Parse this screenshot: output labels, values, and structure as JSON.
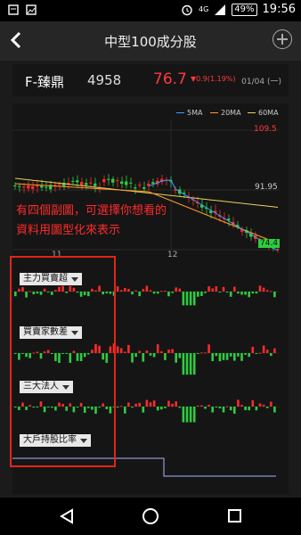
{
  "status_bar": {
    "network": "4G",
    "battery": "49%",
    "time": "19:56",
    "icons": [
      "notification-icon",
      "image-icon",
      "alarm-icon",
      "signal-icon",
      "battery-icon"
    ]
  },
  "header": {
    "title": "中型100成分股"
  },
  "stock": {
    "name": "F-臻鼎",
    "code": "4958",
    "price": "76.7",
    "change": "▼0.9(1.19%)",
    "date": "01/04 (一)"
  },
  "legend": [
    {
      "label": "5MA",
      "color": "#3aa0ff"
    },
    {
      "label": "20MA",
      "color": "#ff9a2a"
    },
    {
      "label": "60MA",
      "color": "#e8d060"
    }
  ],
  "price_labels": {
    "high": "109.5",
    "mid": "91.95",
    "low": "74.4"
  },
  "x_labels": [
    "11",
    "12"
  ],
  "annotation": {
    "line1": "有四個副圖，可選擇你想看的",
    "line2": "資料用圖型化來表示"
  },
  "sub_charts": [
    {
      "label": "主力買賣超"
    },
    {
      "label": "買賣家數差"
    },
    {
      "label": "三大法人"
    },
    {
      "label": "大戶持股比率"
    }
  ],
  "colors": {
    "up": "#ff2a2a",
    "down": "#2ecc40",
    "annotation_frame": "#e1251b"
  },
  "chart_data": [
    {
      "type": "line",
      "title": "",
      "series": [
        {
          "name": "5MA",
          "values": []
        },
        {
          "name": "20MA",
          "values": []
        },
        {
          "name": "60MA",
          "values": []
        }
      ],
      "y_labels": [
        "109.5",
        "91.95",
        "74.4"
      ],
      "x_labels": [
        "11",
        "12"
      ]
    }
  ]
}
